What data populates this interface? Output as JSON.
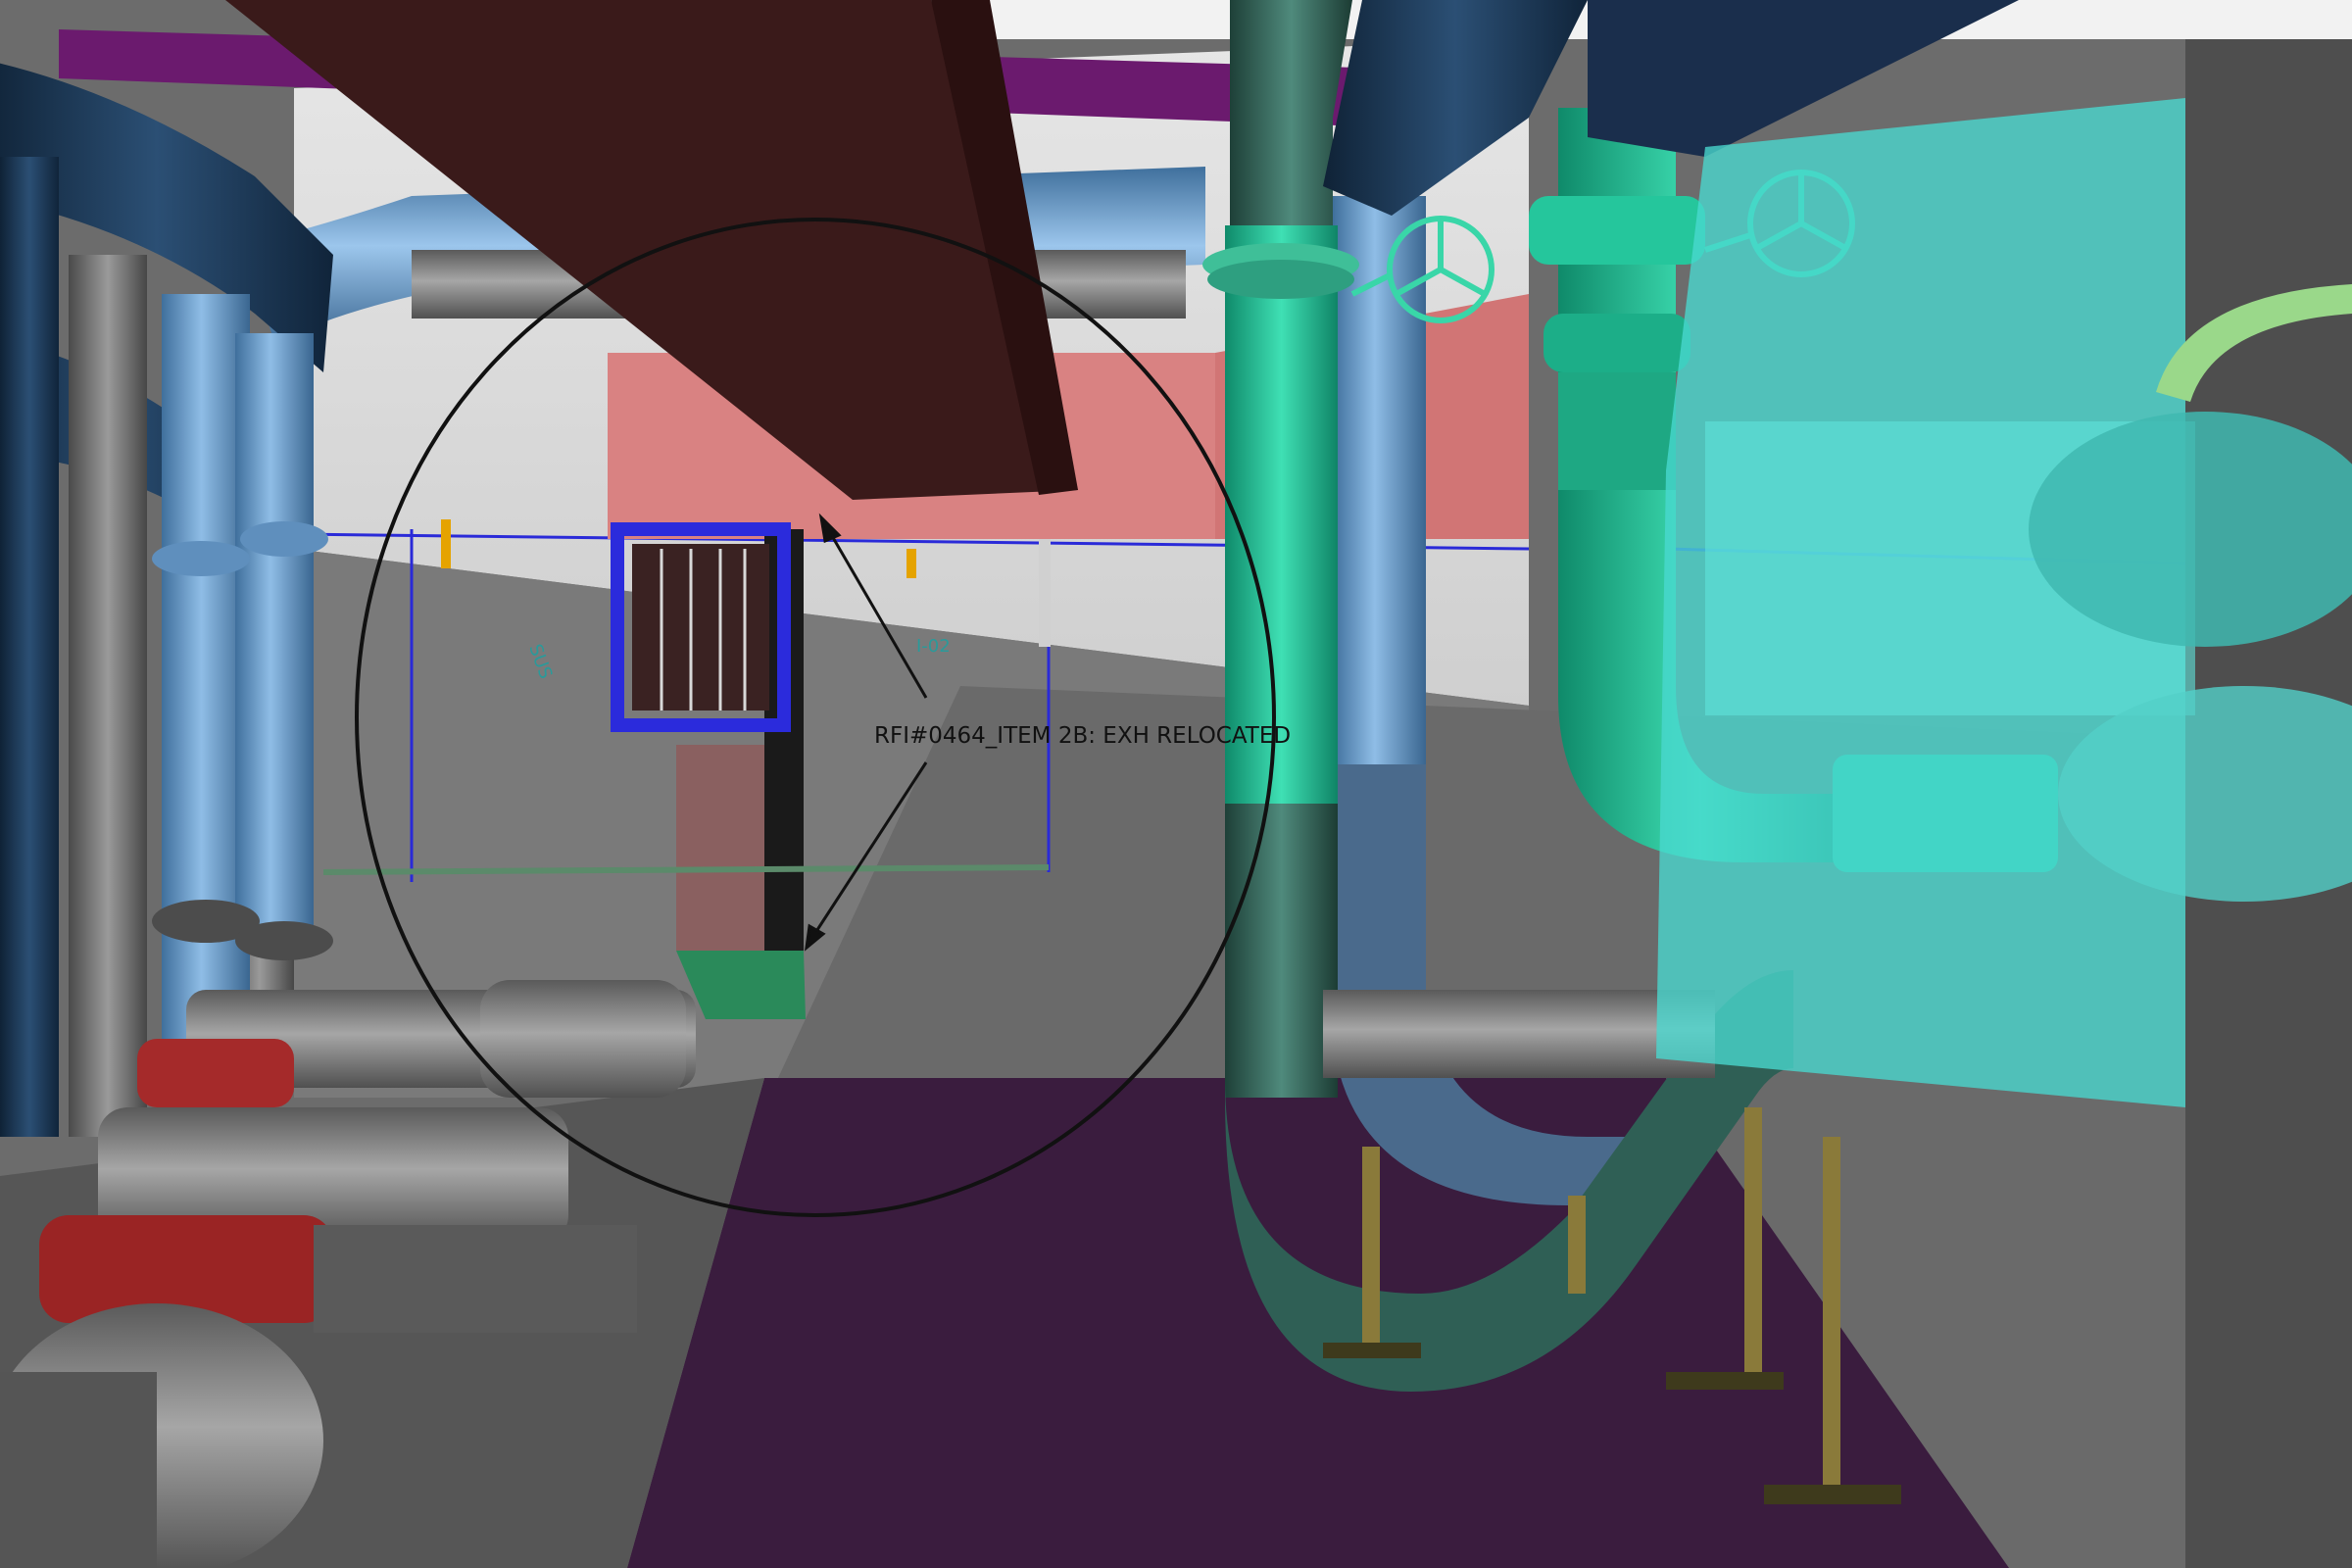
{
  "viewer": {
    "mode": "3D model review",
    "markup_label": "RFI#0464_ITEM 2B: EXH RELOCATED",
    "markup_color": "#111111",
    "minor_tags": [
      "I-02",
      "SUS"
    ]
  },
  "colors": {
    "floor": "#3a1c3e",
    "wall_light": "#d8d8d8",
    "wall_shadow": "#707070",
    "duct_dark": "#3a1a1a",
    "duct_pink": "#d98282",
    "exhaust_grille_frame": "#2b2bdc",
    "pipe_blue": "#6a9ccc",
    "pipe_navy": "#1d3a5c",
    "pipe_teal": "#19b892",
    "pipe_dark_teal": "#2f5f55",
    "equipment_cyan": "#49d8d0",
    "pump_gray": "#7a7a7a",
    "pump_red": "#a52a2a",
    "support_gold": "#8a7a3a"
  },
  "icons": [
    "valve-handwheel-icon",
    "valve-handwheel-icon",
    "markup-circle-icon",
    "leader-arrow-icon"
  ]
}
